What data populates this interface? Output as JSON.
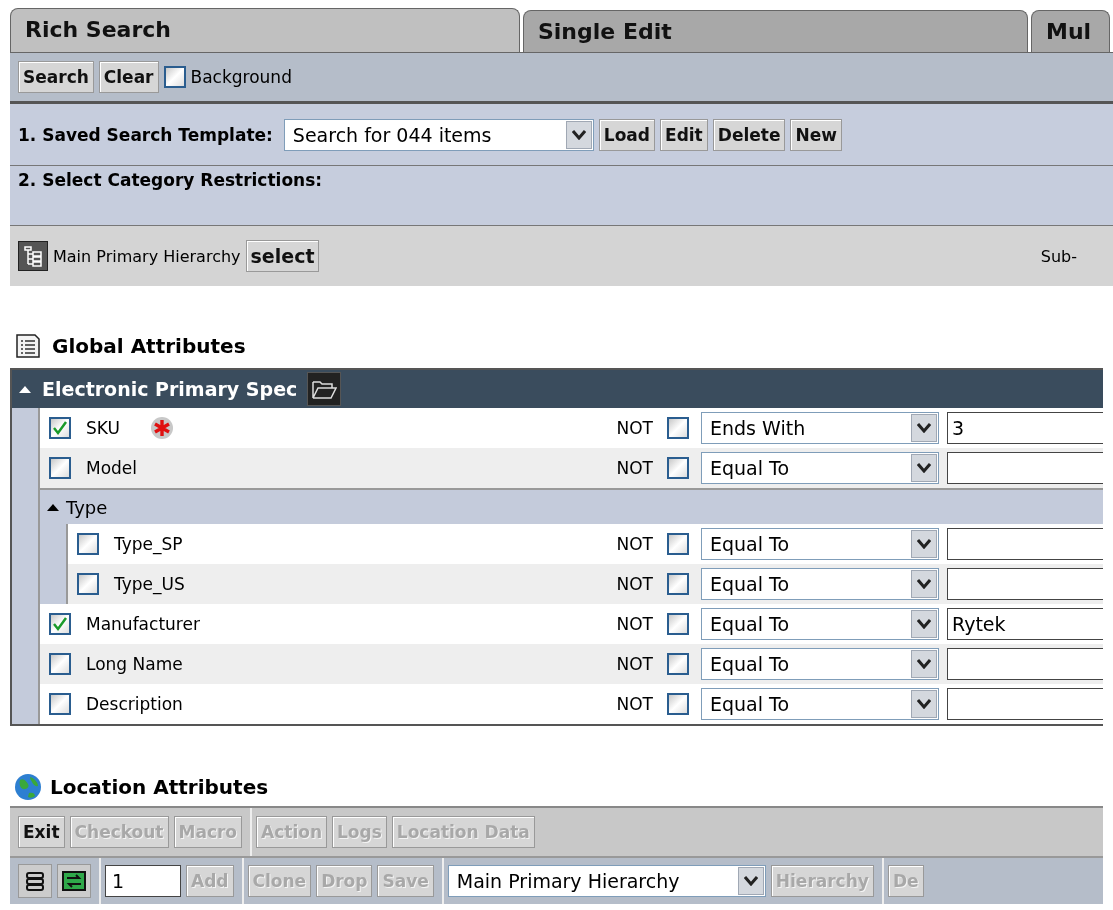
{
  "tabs": [
    {
      "label": "Rich Search",
      "selected": true
    },
    {
      "label": "Single Edit",
      "selected": false
    },
    {
      "label": "Mul",
      "selected": false
    }
  ],
  "search_toolbar": {
    "buttons": [
      "Search",
      "Clear"
    ],
    "background": {
      "label": "Background",
      "checked": false
    }
  },
  "saved_search_template": {
    "label": "1. Saved Search Template:",
    "value": "Search for 044 items",
    "buttons": [
      "Load",
      "Edit",
      "Delete",
      "New"
    ]
  },
  "category_restrictions": {
    "label": "2. Select Category Restrictions:",
    "hierarchy": "Main Primary Hierarchy",
    "select_button": "select",
    "column_2": "Sub-"
  },
  "global_attributes": {
    "title": "Global Attributes",
    "spec": {
      "title": "Electronic Primary Spec",
      "expanded": true
    },
    "rows": [
      {
        "kind": "attribute",
        "label": "SKU",
        "checked": true,
        "required": true,
        "not_label": "NOT",
        "not_checked": false,
        "operator": "Ends With",
        "value": "3"
      },
      {
        "kind": "attribute",
        "label": "Model",
        "checked": false,
        "required": false,
        "not_label": "NOT",
        "not_checked": false,
        "operator": "Equal To"
      },
      {
        "kind": "group",
        "label": "Type",
        "expanded": true,
        "children": [
          {
            "kind": "attribute",
            "label": "Type_SP",
            "checked": false,
            "required": false,
            "not_label": "NOT",
            "not_checked": false,
            "operator": "Equal To"
          },
          {
            "kind": "attribute",
            "label": "Type_US",
            "checked": false,
            "required": false,
            "not_label": "NOT",
            "not_checked": false,
            "operator": "Equal To"
          }
        ]
      },
      {
        "kind": "attribute",
        "label": "Manufacturer",
        "checked": true,
        "required": false,
        "not_label": "NOT",
        "not_checked": false,
        "operator": "Equal To",
        "value": "Rytek"
      },
      {
        "kind": "attribute",
        "label": "Long Name",
        "checked": false,
        "required": false,
        "not_label": "NOT",
        "not_checked": false,
        "operator": "Equal To"
      },
      {
        "kind": "attribute",
        "label": "Description",
        "checked": false,
        "required": false,
        "not_label": "NOT",
        "not_checked": false,
        "operator": "Equal To"
      }
    ]
  },
  "location_attributes": {
    "title": "Location Attributes",
    "toolbar_1": [
      [
        {
          "kind": "button",
          "label": "Exit",
          "disabled": false
        },
        {
          "kind": "button",
          "label": "Checkout",
          "disabled": true
        },
        {
          "kind": "button",
          "label": "Macro",
          "disabled": true
        }
      ],
      [
        {
          "kind": "button",
          "label": "Action",
          "disabled": true
        },
        {
          "kind": "button",
          "label": "Logs",
          "disabled": true
        },
        {
          "kind": "button",
          "label": "Location Data",
          "disabled": true
        }
      ]
    ],
    "toolbar_2": [
      [
        {
          "kind": "list"
        },
        {
          "kind": "refresh"
        }
      ],
      [
        {
          "kind": "input",
          "value": "1"
        },
        {
          "kind": "button",
          "label": "Add",
          "disabled": true
        }
      ],
      [
        {
          "kind": "button",
          "label": "Clone",
          "disabled": true
        },
        {
          "kind": "button",
          "label": "Drop",
          "disabled": true
        },
        {
          "kind": "button",
          "label": "Save",
          "disabled": true
        }
      ],
      [
        {
          "kind": "select",
          "value": "Main Primary Hierarchy"
        },
        {
          "kind": "button",
          "label": "Hierarchy",
          "disabled": true
        }
      ],
      [
        {
          "kind": "button",
          "label": "De",
          "disabled": true
        }
      ]
    ]
  }
}
